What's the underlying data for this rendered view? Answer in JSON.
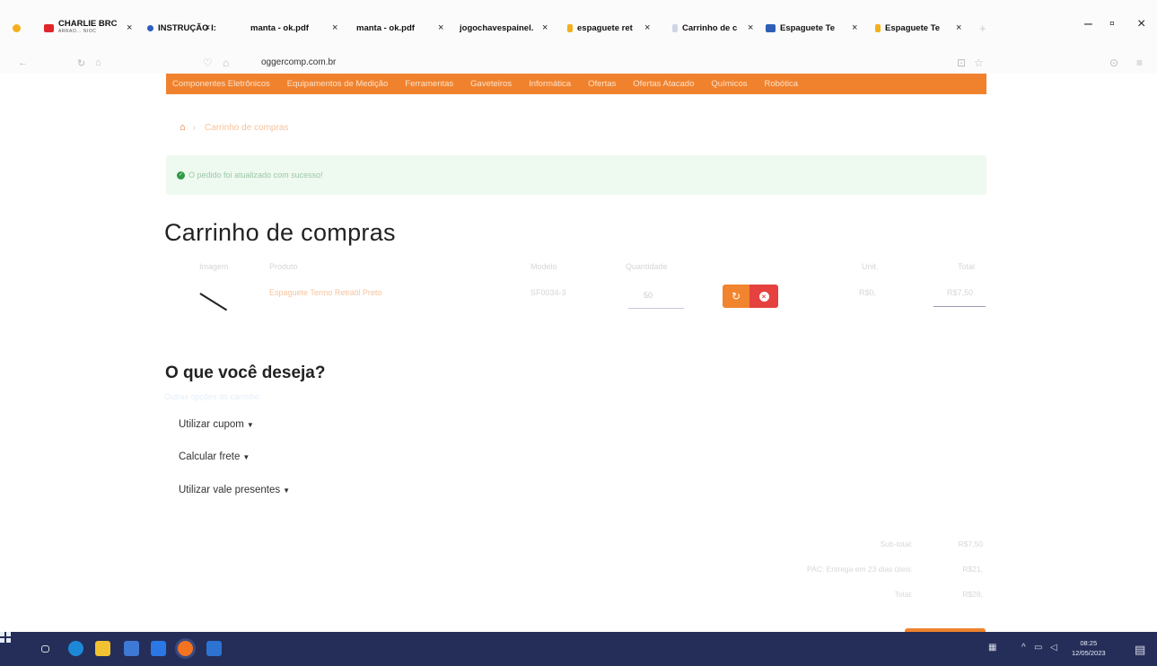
{
  "tabs": [
    {
      "title": "CHARLIE BRC",
      "subtitle": "",
      "icon": "youtube-icon",
      "color": "#e0262b"
    },
    {
      "title": "INSTRUÇÃO I:",
      "icon": "instruction-icon",
      "color": "#2a5fbf"
    },
    {
      "title": "manta - ok.pdf",
      "icon": "pdf-icon",
      "color": ""
    },
    {
      "title": "manta - ok.pdf",
      "icon": "pdf-icon",
      "color": ""
    },
    {
      "title": "jogochavespainel.",
      "icon": "page-icon",
      "color": ""
    },
    {
      "title": "espaguete ret",
      "icon": "google-icon",
      "color": "#f3b01d"
    },
    {
      "title": "Carrinho de c",
      "icon": "page-icon",
      "color": "#cfd6e4"
    },
    {
      "title": "Espaguete Te",
      "icon": "store-icon",
      "color": "#2f5fb5"
    },
    {
      "title": "Espaguete Te",
      "icon": "google-icon",
      "color": "#f3b01d"
    }
  ],
  "address_bar": {
    "url": "oggercomp.com.br"
  },
  "nav_menu": [
    "Componentes Eletrônicos",
    "Equipamentos de Medição",
    "Ferramentas",
    "Gaveteiros",
    "Informática",
    "Ofertas",
    "Ofertas Atacado",
    "Químicos",
    "Robótica"
  ],
  "breadcrumb": {
    "current": "Carrinho de compras"
  },
  "alert": {
    "message": "O pedido foi atualizado com sucesso!"
  },
  "cart": {
    "title": "Carrinho de compras",
    "headers": {
      "image": "Imagem",
      "product": "Produto",
      "model": "Modelo",
      "quantity": "Quantidade",
      "unit": "Unit.",
      "total": "Total"
    },
    "item": {
      "name": "Espaguete Termo Retrátil Preto",
      "model": "SF0034-3",
      "quantity": "50",
      "unit_price": "R$0,",
      "total": "R$7,50"
    }
  },
  "options": {
    "title": "O que você deseja?",
    "subtitle": "Outras opções do carrinho",
    "toggles": [
      {
        "label": "Utilizar cupom"
      },
      {
        "label": "Calcular frete"
      },
      {
        "label": "Utilizar vale presentes"
      }
    ]
  },
  "totals": {
    "subtotal_label": "Sub-total:",
    "subtotal_value": "R$7,50",
    "shipping_label": "PAC: Entrega em 23 dias úteis:",
    "shipping_value": "R$21,",
    "total_label": "Total:",
    "total_value": "R$28,"
  },
  "taskbar": {
    "time": "08:25",
    "date": "12/05/2023"
  },
  "colors": {
    "accent_orange": "#f0822e",
    "danger_red": "#e5413f",
    "success_green": "#2e9a45",
    "taskbar": "#242e58"
  }
}
